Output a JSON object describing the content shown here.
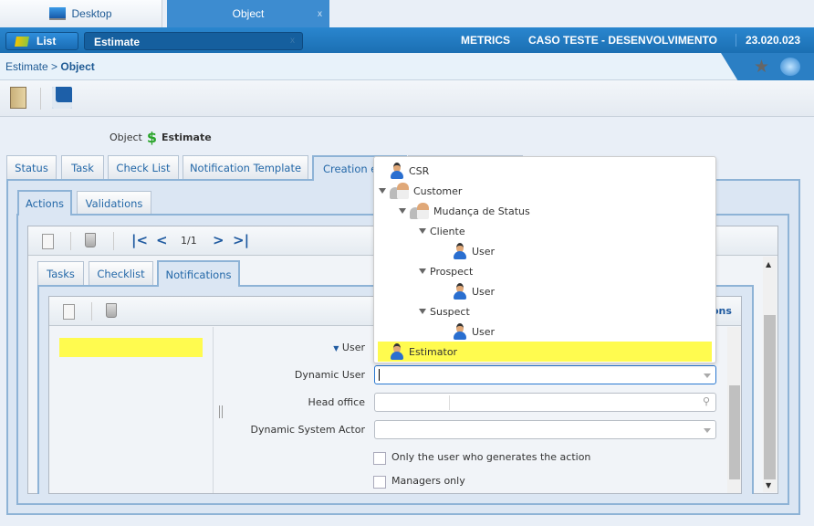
{
  "window_tabs": [
    {
      "label": "Desktop",
      "icon": "monitor-icon"
    },
    {
      "label": "Object",
      "close": "x"
    }
  ],
  "header": {
    "list_label": "List",
    "record": "Estimate",
    "record_close": "x",
    "metrics": "METRICS",
    "company": "CASO TESTE - DESENVOLVIMENTO",
    "version": "23.020.023"
  },
  "breadcrumb": {
    "parent": "Estimate",
    "separator": ">",
    "current": "Object"
  },
  "object_title": {
    "label": "Object",
    "value": "Estimate"
  },
  "main_tabs": [
    "Status",
    "Task",
    "Check List",
    "Notification Template",
    "Creation e"
  ],
  "sub_tabs": [
    "Actions",
    "Validations"
  ],
  "pager": {
    "page": "1/1"
  },
  "detail_tabs": [
    "Tasks",
    "Checklist",
    "Notifications"
  ],
  "hidden_tab_fragment": "ons",
  "form": {
    "user_label": "User",
    "dynamic_user_label": "Dynamic User",
    "head_office_label": "Head office",
    "dynamic_system_actor_label": "Dynamic System Actor",
    "only_user_label": "Only the user who generates the action",
    "managers_only_label": "Managers only"
  },
  "dropdown": {
    "items": [
      {
        "label": "CSR",
        "icon": "user-icon",
        "level": 0
      },
      {
        "label": "Customer",
        "icon": "group-icon",
        "level": 0,
        "expanded": true
      },
      {
        "label": "Mudança de Status",
        "icon": "group-icon",
        "level": 1,
        "expanded": true
      },
      {
        "label": "Cliente",
        "level": 2,
        "expanded": true
      },
      {
        "label": "User",
        "icon": "user-icon",
        "level": 3
      },
      {
        "label": "Prospect",
        "level": 2,
        "expanded": true
      },
      {
        "label": "User",
        "icon": "user-icon",
        "level": 3
      },
      {
        "label": "Suspect",
        "level": 2,
        "expanded": true
      },
      {
        "label": "User",
        "icon": "user-icon",
        "level": 3
      },
      {
        "label": "Estimator",
        "icon": "user-icon",
        "level": 0,
        "highlighted": true
      }
    ]
  },
  "colors": {
    "highlight": "#fffb4f",
    "brand_blue": "#1e78c0",
    "link_blue": "#2468a8"
  }
}
